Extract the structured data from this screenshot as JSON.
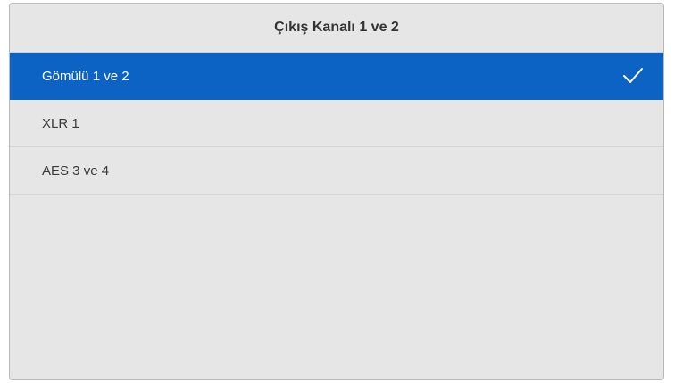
{
  "dialog": {
    "title": "Çıkış Kanalı 1 ve 2"
  },
  "options": [
    {
      "label": "Gömülü 1 ve 2",
      "selected": true
    },
    {
      "label": "XLR 1",
      "selected": false
    },
    {
      "label": "AES 3 ve 4",
      "selected": false
    }
  ],
  "colors": {
    "selected_bg": "#0c63c3",
    "panel_bg": "#e6e6e6"
  },
  "icons": {
    "selected_marker": "check-icon"
  }
}
